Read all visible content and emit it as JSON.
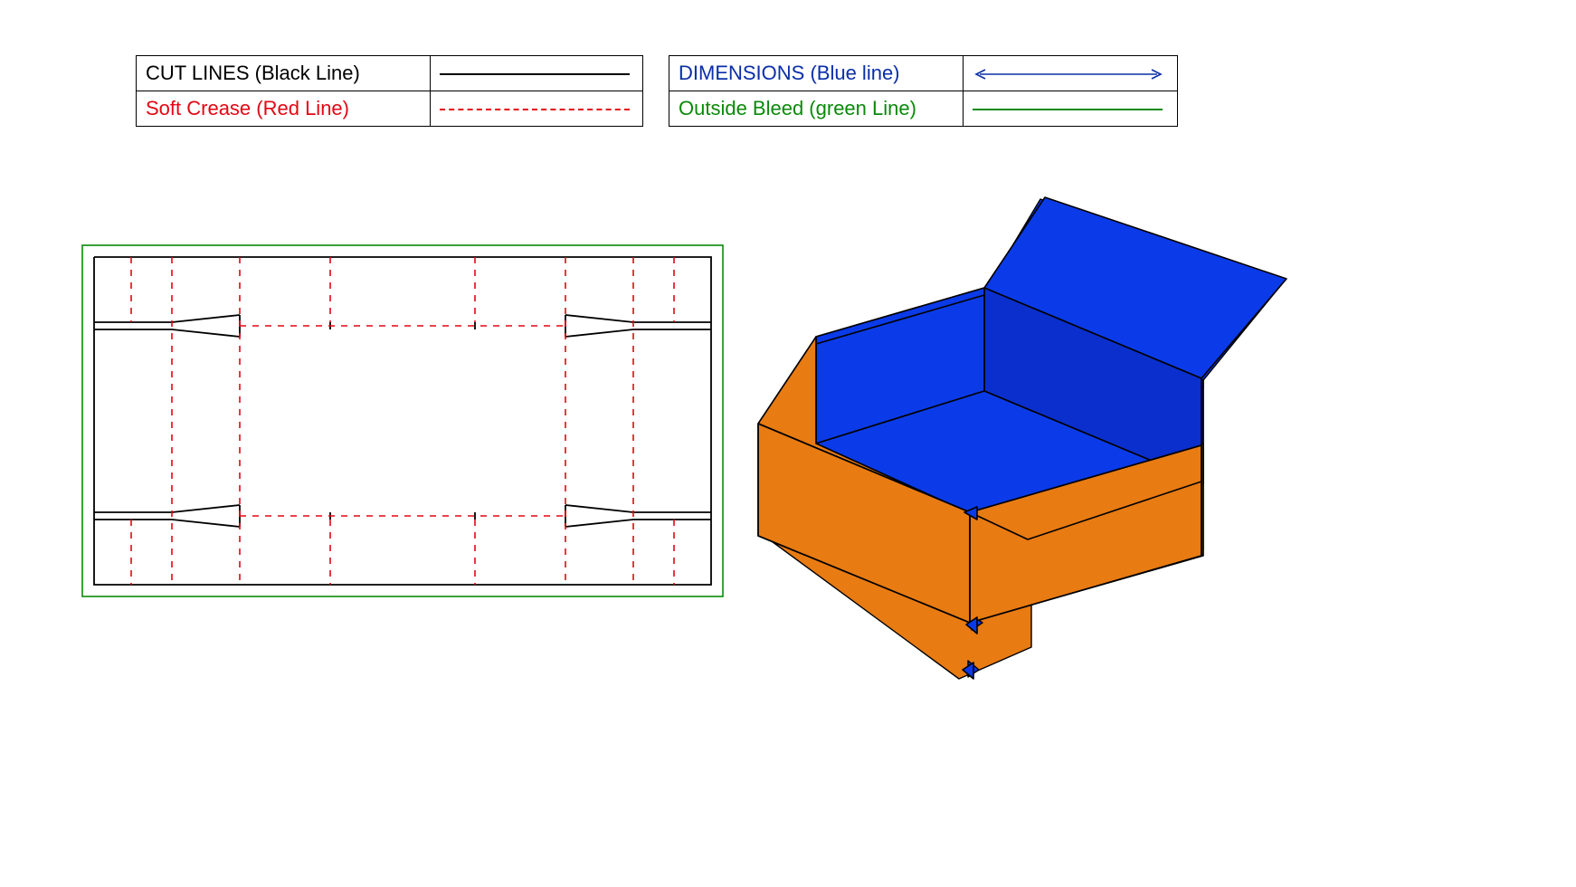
{
  "legend": {
    "left": [
      {
        "label": "CUT LINES (Black Line)",
        "color_class": "t-black",
        "swatch": "solid-black"
      },
      {
        "label": "Soft Crease (Red Line)",
        "color_class": "t-red",
        "swatch": "dashed-red"
      }
    ],
    "right": [
      {
        "label": "DIMENSIONS (Blue line)",
        "color_class": "t-blue",
        "swatch": "arrow-blue"
      },
      {
        "label": "Outside Bleed (green Line)",
        "color_class": "t-green",
        "swatch": "solid-green"
      }
    ]
  },
  "colors": {
    "cut": "#000000",
    "crease": "#e30613",
    "bleed": "#0a8a0a",
    "dimension": "#0a2ea8",
    "box_outer": "#e87b12",
    "box_inner": "#0b3be8",
    "box_inner_dark": "#0a2fcc"
  },
  "diagram": {
    "type": "packaging-dieline",
    "description": "Flat dieline template for a corrugated tray/indestructo mailer box with roll-over side walls, shown beside a 3D render of the assembled box (orange exterior, blue interior).",
    "line_conventions": {
      "cut": "solid black",
      "soft_crease": "dashed red",
      "dimensions": "double-arrow blue",
      "outside_bleed": "solid green rectangle enclosing the dieline"
    }
  }
}
